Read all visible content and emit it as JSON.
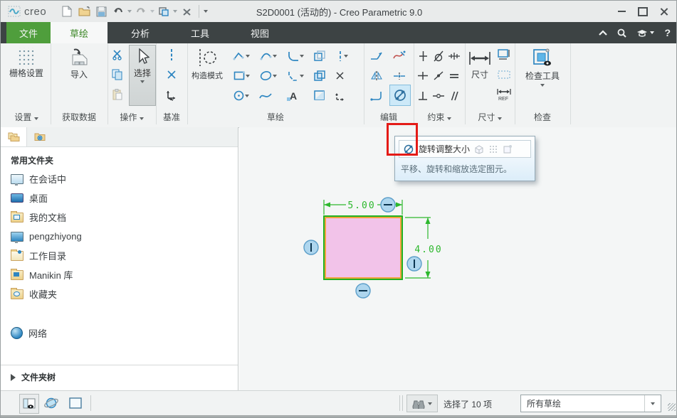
{
  "window": {
    "title": "S2D0001 (活动的) - Creo Parametric 9.0",
    "logo_text": "creo",
    "help_label": "?"
  },
  "tabs": {
    "file": "文件",
    "sketch": "草绘",
    "analysis": "分析",
    "tools": "工具",
    "view": "视图",
    "active_tab": "草绘"
  },
  "ribbon": {
    "settings": {
      "grid_button": "栅格设置",
      "label": "设置"
    },
    "get_data": {
      "import_button": "导入",
      "label": "获取数据"
    },
    "operations": {
      "select_button": "选择",
      "label": "操作"
    },
    "datum": {
      "label": "基准"
    },
    "sketch": {
      "construction_button": "构造模式",
      "label": "草绘",
      "text_tool_glyph": "A"
    },
    "edit": {
      "label": "编辑"
    },
    "constrain": {
      "label": "约束"
    },
    "dimension": {
      "dim_button": "尺寸",
      "label": "尺寸",
      "ref_glyph": "REF"
    },
    "inspect": {
      "inspect_button": "检查工具",
      "label": "检查"
    }
  },
  "sidebar": {
    "header": "常用文件夹",
    "items": [
      {
        "icon": "in-session-monitor-icon",
        "label": "在会话中"
      },
      {
        "icon": "desktop-icon",
        "label": "桌面"
      },
      {
        "icon": "documents-folder-icon",
        "label": "我的文档"
      },
      {
        "icon": "computer-icon",
        "label": "pengzhiyong"
      },
      {
        "icon": "working-directory-folder-icon",
        "label": "工作目录"
      },
      {
        "icon": "library-folder-icon",
        "label": "Manikin 库"
      },
      {
        "icon": "favorites-folder-icon",
        "label": "收藏夹"
      },
      {
        "icon": "network-globe-icon",
        "label": "网络"
      }
    ],
    "folder_tree": "文件夹树"
  },
  "tooltip": {
    "title": "旋转调整大小",
    "description": "平移、旋转和缩放选定图元。"
  },
  "sketch_canvas": {
    "width_dim": "5.00",
    "height_dim": "4.00"
  },
  "statusbar": {
    "selected_text": "选择了 10 项",
    "filter_value": "所有草绘"
  },
  "colors": {
    "tab_green": "#4f9e3c",
    "active_tab_text": "#3c8726",
    "dimension_green": "#2db82d",
    "rect_fill": "#f2c3e9",
    "rect_border_orange": "#f0a33c",
    "constraint_fill": "#aed6ee",
    "highlight_red": "#e41b17",
    "icon_blue": "#2e86c1"
  }
}
